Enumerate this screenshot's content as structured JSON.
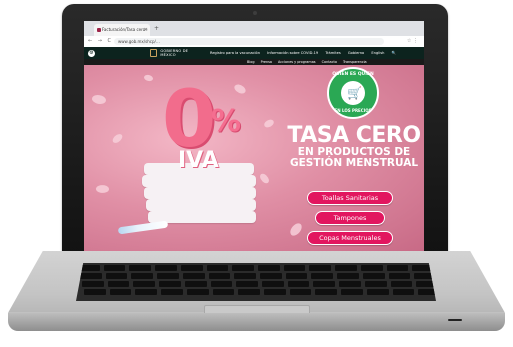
{
  "browser": {
    "tab_title": "Facturación/Tasa cero · ",
    "tab_close": "×",
    "new_tab": "+",
    "url": "www.gob.mx/shcp/…",
    "nav_icons": "← → C",
    "address_right": "☆ ⋮",
    "window_dot_colors": [
      "#ee5a52",
      "#f5bd4f",
      "#5fc454"
    ]
  },
  "gov_header": {
    "logo_text_line1": "GOBIERNO DE",
    "logo_text_line2": "MÉXICO",
    "nav_items": [
      "Registro para la vacunación",
      "Información sobre COVID-19",
      "Trámites",
      "Gobierno",
      "English",
      "🔍"
    ]
  },
  "sub_nav": {
    "items": [
      "Blog",
      "Prensa",
      "Acciones y programas",
      "Contacto",
      "Transparencia"
    ]
  },
  "hero": {
    "zero": "0",
    "percent": "%",
    "iva": "IVA",
    "badge_top": "QUIEN ES QUIEN",
    "badge_bottom": "EN LOS PRECIOS",
    "headline": "TASA CERO",
    "subhead_line1": "EN PRODUCTOS DE",
    "subhead_line2": "GESTIÓN MENSTRUAL",
    "buttons": [
      "Toallas Sanitarias",
      "Tampones",
      "Copas Menstruales"
    ],
    "colors": {
      "background": "#e08fa5",
      "button": "#e2165f",
      "badge": "#2aa854",
      "accent_pink": "#f26c8c"
    }
  }
}
